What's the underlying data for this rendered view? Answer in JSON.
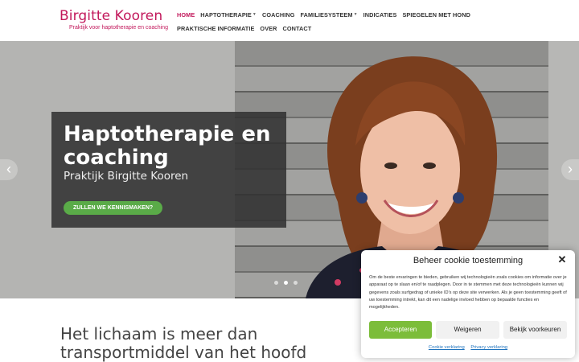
{
  "logo": {
    "title": "Birgitte Kooren",
    "tagline": "Praktijk voor haptotherapie en coaching",
    "color": "#c2185b"
  },
  "nav": {
    "row1": [
      {
        "label": "HOME",
        "active": true,
        "dropdown": false
      },
      {
        "label": "HAPTOTHERAPIE",
        "active": false,
        "dropdown": true
      },
      {
        "label": "COACHING",
        "active": false,
        "dropdown": false
      },
      {
        "label": "FAMILIESYSTEEM",
        "active": false,
        "dropdown": true
      },
      {
        "label": "INDICATIES",
        "active": false,
        "dropdown": false
      },
      {
        "label": "SPIEGELEN MET HOND",
        "active": false,
        "dropdown": false
      }
    ],
    "row2": [
      {
        "label": "PRAKTISCHE INFORMATIE",
        "active": false,
        "dropdown": false
      },
      {
        "label": "OVER",
        "active": false,
        "dropdown": false
      },
      {
        "label": "CONTACT",
        "active": false,
        "dropdown": false
      }
    ]
  },
  "hero": {
    "title": "Haptotherapie en coaching",
    "subtitle": "Praktijk Birgitte Kooren",
    "cta_label": "ZULLEN WE KENNISMAKEN?",
    "cta_color": "#5aab48",
    "prev_icon": "chevron-left-icon",
    "next_icon": "chevron-right-icon",
    "slides": 3,
    "active_slide": 2
  },
  "intro": {
    "line1": "Het lichaam is meer dan",
    "line2": "transportmiddel van het hoofd"
  },
  "cookie": {
    "title": "Beheer cookie toestemming",
    "text": "Om de beste ervaringen te bieden, gebruiken wij technologieën zoals cookies om informatie over je apparaat op te slaan en/of te raadplegen. Door in te stemmen met deze technologieën kunnen wij gegevens zoals surfgedrag of unieke ID's op deze site verwerken. Als je geen toestemming geeft of uw toestemming intrekt, kan dit een nadelige invloed hebben op bepaalde functies en mogelijkheden.",
    "accept_label": "Accepteren",
    "deny_label": "Weigeren",
    "preferences_label": "Bekijk voorkeuren",
    "cookie_policy_link": "Cookie verklaring",
    "privacy_policy_link": "Privacy verklaring",
    "accept_color": "#7cbd3a"
  }
}
